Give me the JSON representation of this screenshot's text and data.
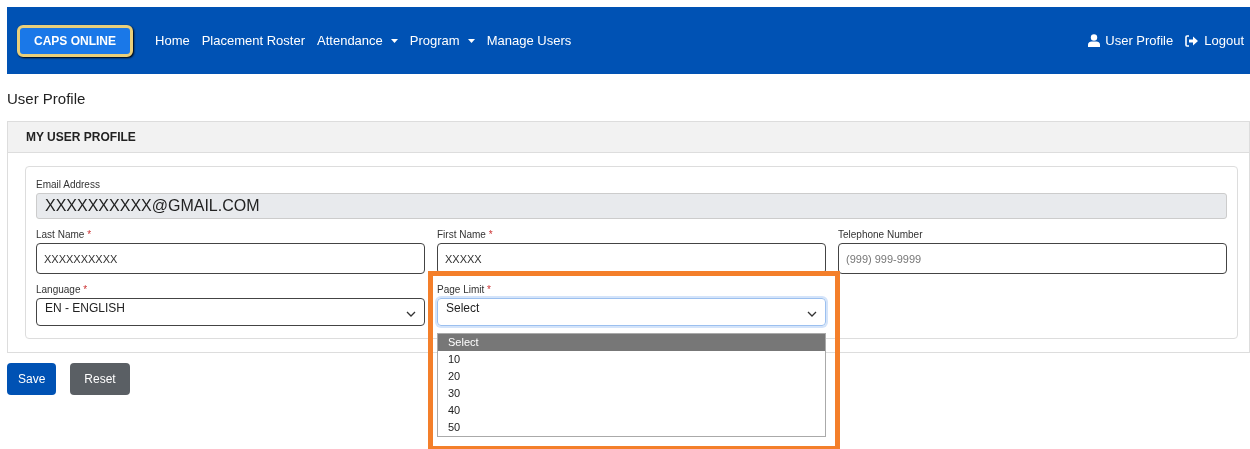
{
  "navbar": {
    "logo": "CAPS ONLINE",
    "items": [
      {
        "label": "Home",
        "dropdown": false
      },
      {
        "label": "Placement Roster",
        "dropdown": false
      },
      {
        "label": "Attendance",
        "dropdown": true
      },
      {
        "label": "Program",
        "dropdown": true
      },
      {
        "label": "Manage Users",
        "dropdown": false
      }
    ],
    "right_items": [
      {
        "kind": "user",
        "label": "User Profile"
      },
      {
        "kind": "logout",
        "label": "Logout"
      }
    ]
  },
  "page_title": "User Profile",
  "card": {
    "header": "MY USER PROFILE",
    "email": {
      "label": "Email Address",
      "value": "XXXXXXXXXX@GMAIL.COM"
    },
    "row_fields": [
      {
        "kind": "input",
        "label": "Last Name",
        "required_mark": "*",
        "value": "XXXXXXXXXX"
      },
      {
        "kind": "input",
        "label": "First Name",
        "required_mark": "*",
        "value": "XXXXX"
      },
      {
        "kind": "input",
        "label": "Telephone Number",
        "placeholder": "(999) 999-9999"
      }
    ],
    "select_fields": [
      {
        "label": "Language",
        "required_mark": "*",
        "value": "EN - ENGLISH",
        "open": false
      },
      {
        "label": "Page Limit",
        "required_mark": "*",
        "value": "Select",
        "open": true,
        "highlighted": true,
        "options": [
          {
            "label": "Select",
            "selected": true
          },
          {
            "label": "10",
            "selected": false
          },
          {
            "label": "20",
            "selected": false
          },
          {
            "label": "30",
            "selected": false
          },
          {
            "label": "40",
            "selected": false
          },
          {
            "label": "50",
            "selected": false
          }
        ]
      }
    ]
  },
  "buttons": [
    {
      "kind": "primary",
      "label": "Save"
    },
    {
      "kind": "secondary",
      "label": "Reset"
    }
  ]
}
